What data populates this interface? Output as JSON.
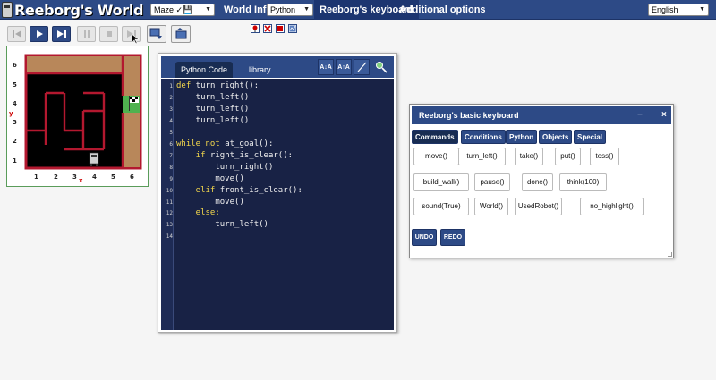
{
  "app": {
    "title": "Reeborg's World"
  },
  "topbar": {
    "world_select": "Maze ✓💾",
    "world_info": "World Info",
    "language_select": "Python",
    "keyboard_menu": "Reeborg's keyboard",
    "additional_options": "Additional options",
    "locale_select": "English"
  },
  "controls": [
    {
      "name": "reverse-step",
      "state": "disabled"
    },
    {
      "name": "run",
      "state": "enabled"
    },
    {
      "name": "step",
      "state": "enabled"
    },
    {
      "name": "pause",
      "state": "disabled"
    },
    {
      "name": "stop",
      "state": "disabled"
    },
    {
      "name": "step-forward",
      "state": "disabled"
    }
  ],
  "world": {
    "y_labels": [
      "6",
      "5",
      "4",
      "3",
      "2",
      "1"
    ],
    "x_labels": [
      "1",
      "2",
      "3",
      "4",
      "5",
      "6"
    ],
    "x_axis_marker": "x",
    "y_axis_marker": "y"
  },
  "editor": {
    "tabs": [
      "Python Code",
      "library"
    ],
    "tools": [
      "A↓A",
      "A↑A"
    ],
    "line_numbers": [
      "1",
      "2",
      "3",
      "4",
      "5",
      "6",
      "7",
      "8",
      "9",
      "10",
      "11",
      "12",
      "13",
      "14"
    ],
    "code": [
      {
        "kw": "def",
        "rest": " turn_right():"
      },
      {
        "kw": "",
        "rest": "    turn_left()"
      },
      {
        "kw": "",
        "rest": "    turn_left()"
      },
      {
        "kw": "",
        "rest": "    turn_left()"
      },
      {
        "kw": "",
        "rest": ""
      },
      {
        "kw": "while not",
        "rest": " at_goal():"
      },
      {
        "kw": "    if",
        "rest": " right_is_clear():"
      },
      {
        "kw": "",
        "rest": "        turn_right()"
      },
      {
        "kw": "",
        "rest": "        move()"
      },
      {
        "kw": "    elif",
        "rest": " front_is_clear():"
      },
      {
        "kw": "",
        "rest": "        move()"
      },
      {
        "kw": "    else:",
        "rest": ""
      },
      {
        "kw": "",
        "rest": "        turn_left()"
      },
      {
        "kw": "",
        "rest": ""
      }
    ]
  },
  "keyboard": {
    "title": "Reeborg's basic keyboard",
    "minimize": "−",
    "close": "×",
    "tabs": [
      "Commands",
      "Conditions",
      "Python",
      "Objects",
      "Special"
    ],
    "commands": [
      "move()",
      "turn_left()",
      "take()",
      "put()",
      "toss()",
      "build_wall()",
      "pause()",
      "done()",
      "think(100)",
      "sound(True)",
      "World()",
      "UsedRobot()",
      "no_highlight()"
    ],
    "undo": "UNDO",
    "redo": "REDO"
  },
  "colors": {
    "brand": "#2d4a86",
    "editor_bg": "#182245",
    "keyword": "#f5d94c",
    "wall": "#b3182f",
    "dirt": "#b8875a",
    "goal": "#4fb24f"
  }
}
